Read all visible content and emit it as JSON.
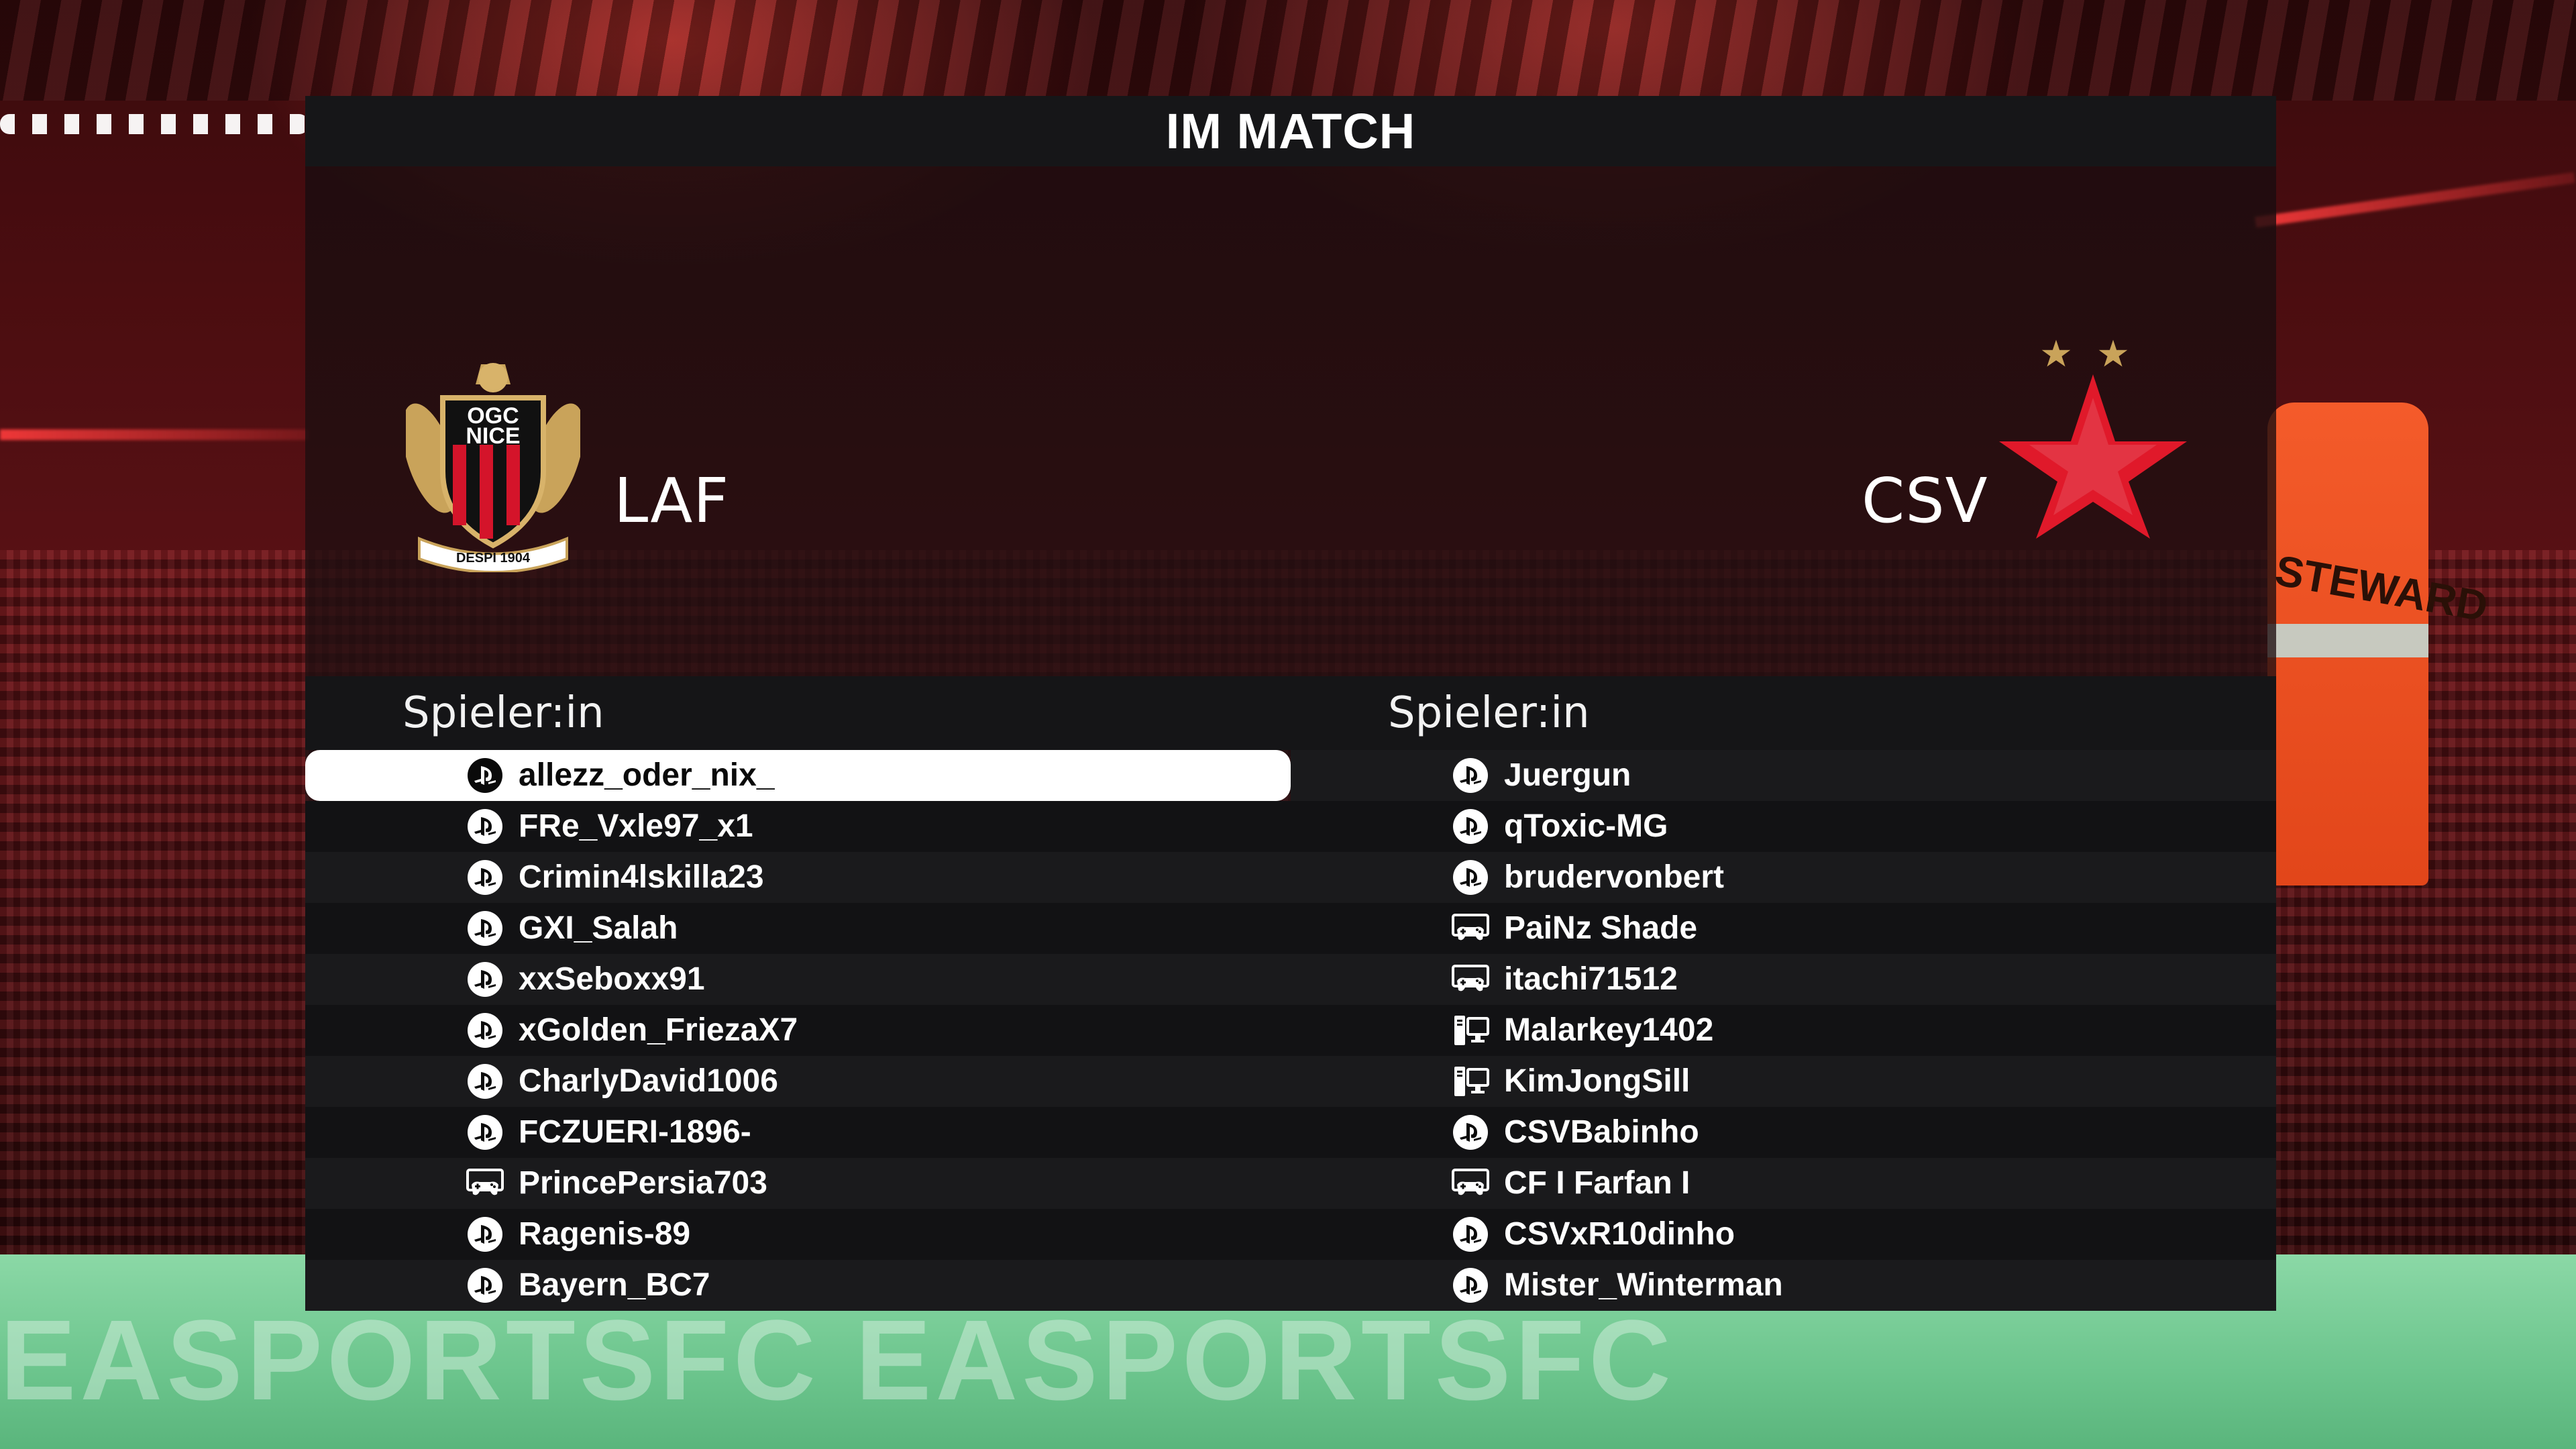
{
  "screen": {
    "title": "IM MATCH"
  },
  "colors": {
    "panel_bg": "#161618",
    "selected_row": "#ffffff",
    "accent_red": "#e0192a"
  },
  "background": {
    "pitch_text": "EASPORTSFC  EASPORTSFC",
    "steward_text": "STEWARD"
  },
  "home_team": {
    "name": "LAF",
    "crest": {
      "icon": "ogc-nice-crest",
      "top_text": "OGC",
      "bottom_text": "NICE",
      "banner": "DESPI 1904"
    },
    "roster_header": "Spieler:in",
    "players": [
      {
        "name": "allezz_oder_nix_",
        "platform": "playstation-icon",
        "selected": true
      },
      {
        "name": "FRe_Vxle97_x1",
        "platform": "playstation-icon"
      },
      {
        "name": "Crimin4lskilla23",
        "platform": "playstation-icon"
      },
      {
        "name": "GXI_Salah",
        "platform": "playstation-icon"
      },
      {
        "name": "xxSeboxx91",
        "platform": "playstation-icon"
      },
      {
        "name": "xGolden_FriezaX7",
        "platform": "playstation-icon"
      },
      {
        "name": "CharlyDavid1006",
        "platform": "playstation-icon"
      },
      {
        "name": "FCZUERI-1896-",
        "platform": "playstation-icon"
      },
      {
        "name": "PrincePersia703",
        "platform": "xbox-controller-icon"
      },
      {
        "name": "Ragenis-89",
        "platform": "playstation-icon"
      },
      {
        "name": "Bayern_BC7",
        "platform": "playstation-icon"
      }
    ]
  },
  "away_team": {
    "name": "CSV",
    "crest": {
      "icon": "red-star-crest",
      "stars": 2
    },
    "roster_header": "Spieler:in",
    "players": [
      {
        "name": "Juergun",
        "platform": "playstation-icon"
      },
      {
        "name": "qToxic-MG",
        "platform": "playstation-icon"
      },
      {
        "name": "brudervonbert",
        "platform": "playstation-icon"
      },
      {
        "name": "PaiNz Shade",
        "platform": "xbox-controller-icon"
      },
      {
        "name": "itachi71512",
        "platform": "xbox-controller-icon"
      },
      {
        "name": "Malarkey1402",
        "platform": "pc-icon"
      },
      {
        "name": "KimJongSill",
        "platform": "pc-icon"
      },
      {
        "name": "CSVBabinho",
        "platform": "playstation-icon"
      },
      {
        "name": "CF I Farfan I",
        "platform": "xbox-controller-icon"
      },
      {
        "name": "CSVxR10dinho",
        "platform": "playstation-icon"
      },
      {
        "name": "Mister_Winterman",
        "platform": "playstation-icon"
      }
    ]
  }
}
